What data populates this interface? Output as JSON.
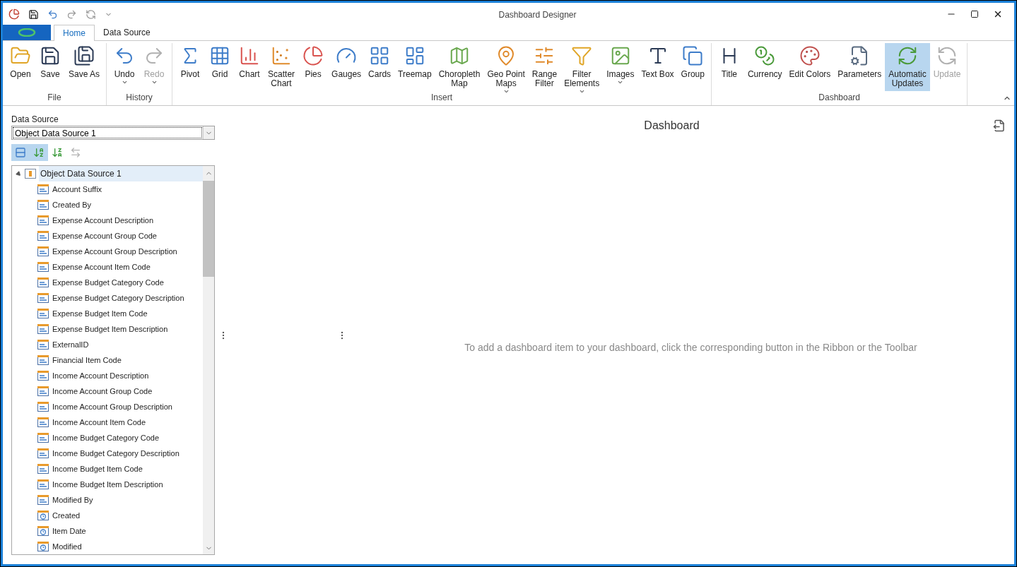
{
  "window": {
    "title": "Dashboard Designer"
  },
  "ribbon_tabs": [
    {
      "label": "Home",
      "selected": true
    },
    {
      "label": "Data Source",
      "selected": false
    }
  ],
  "ribbon_groups": [
    {
      "label": "File",
      "buttons": [
        {
          "label": "Open",
          "disabled": false,
          "selected": false,
          "dropdown": false
        },
        {
          "label": "Save",
          "disabled": false,
          "selected": false,
          "dropdown": false
        },
        {
          "label": "Save As",
          "disabled": false,
          "selected": false,
          "dropdown": false
        }
      ]
    },
    {
      "label": "History",
      "buttons": [
        {
          "label": "Undo",
          "disabled": false,
          "selected": false,
          "dropdown": true
        },
        {
          "label": "Redo",
          "disabled": true,
          "selected": false,
          "dropdown": true
        }
      ]
    },
    {
      "label": "Insert",
      "buttons": [
        {
          "label": "Pivot",
          "disabled": false,
          "selected": false,
          "dropdown": false
        },
        {
          "label": "Grid",
          "disabled": false,
          "selected": false,
          "dropdown": false
        },
        {
          "label": "Chart",
          "disabled": false,
          "selected": false,
          "dropdown": false
        },
        {
          "label": "Scatter\nChart",
          "disabled": false,
          "selected": false,
          "dropdown": false
        },
        {
          "label": "Pies",
          "disabled": false,
          "selected": false,
          "dropdown": false
        },
        {
          "label": "Gauges",
          "disabled": false,
          "selected": false,
          "dropdown": false
        },
        {
          "label": "Cards",
          "disabled": false,
          "selected": false,
          "dropdown": false
        },
        {
          "label": "Treemap",
          "disabled": false,
          "selected": false,
          "dropdown": false
        },
        {
          "label": "Choropleth\nMap",
          "disabled": false,
          "selected": false,
          "dropdown": false
        },
        {
          "label": "Geo Point\nMaps",
          "disabled": false,
          "selected": false,
          "dropdown": true
        },
        {
          "label": "Range\nFilter",
          "disabled": false,
          "selected": false,
          "dropdown": false
        },
        {
          "label": "Filter\nElements",
          "disabled": false,
          "selected": false,
          "dropdown": true
        },
        {
          "label": "Images",
          "disabled": false,
          "selected": false,
          "dropdown": true
        },
        {
          "label": "Text Box",
          "disabled": false,
          "selected": false,
          "dropdown": false
        },
        {
          "label": "Group",
          "disabled": false,
          "selected": false,
          "dropdown": false
        }
      ]
    },
    {
      "label": "Dashboard",
      "buttons": [
        {
          "label": "Title",
          "disabled": false,
          "selected": false,
          "dropdown": false
        },
        {
          "label": "Currency",
          "disabled": false,
          "selected": false,
          "dropdown": false
        },
        {
          "label": "Edit Colors",
          "disabled": false,
          "selected": false,
          "dropdown": false
        },
        {
          "label": "Parameters",
          "disabled": false,
          "selected": false,
          "dropdown": false
        },
        {
          "label": "Automatic\nUpdates",
          "disabled": false,
          "selected": true,
          "dropdown": false
        },
        {
          "label": "Update",
          "disabled": true,
          "selected": false,
          "dropdown": false
        }
      ]
    }
  ],
  "data_source": {
    "label": "Data Source",
    "value": "Object Data Source 1"
  },
  "field_toolbar": [
    {
      "selected": true,
      "disabled": false
    },
    {
      "selected": true,
      "disabled": false
    },
    {
      "selected": false,
      "disabled": false
    },
    {
      "selected": false,
      "disabled": true
    }
  ],
  "tree": {
    "label": "Object Data Source 1",
    "expanded": true,
    "selected": true,
    "children": [
      {
        "label": "Account Suffix",
        "kind": "text"
      },
      {
        "label": "Created By",
        "kind": "text"
      },
      {
        "label": "Expense Account Description",
        "kind": "text"
      },
      {
        "label": "Expense Account Group Code",
        "kind": "text"
      },
      {
        "label": "Expense Account Group Description",
        "kind": "text"
      },
      {
        "label": "Expense Account Item Code",
        "kind": "text"
      },
      {
        "label": "Expense Budget Category Code",
        "kind": "text"
      },
      {
        "label": "Expense Budget Category Description",
        "kind": "text"
      },
      {
        "label": "Expense Budget Item Code",
        "kind": "text"
      },
      {
        "label": "Expense Budget Item Description",
        "kind": "text"
      },
      {
        "label": "ExternalID",
        "kind": "text"
      },
      {
        "label": "Financial Item Code",
        "kind": "text"
      },
      {
        "label": "Income Account Description",
        "kind": "text"
      },
      {
        "label": "Income Account Group Code",
        "kind": "text"
      },
      {
        "label": "Income Account Group Description",
        "kind": "text"
      },
      {
        "label": "Income Account Item Code",
        "kind": "text"
      },
      {
        "label": "Income Budget Category Code",
        "kind": "text"
      },
      {
        "label": "Income Budget Category Description",
        "kind": "text"
      },
      {
        "label": "Income Budget Item Code",
        "kind": "text"
      },
      {
        "label": "Income Budget Item Description",
        "kind": "text"
      },
      {
        "label": "Modified By",
        "kind": "text"
      },
      {
        "label": "Created",
        "kind": "date"
      },
      {
        "label": "Item Date",
        "kind": "date"
      },
      {
        "label": "Modified",
        "kind": "date"
      }
    ]
  },
  "dashboard": {
    "title": "Dashboard",
    "message": "To add a dashboard item to your dashboard, click the corresponding button in the Ribbon or the Toolbar"
  }
}
